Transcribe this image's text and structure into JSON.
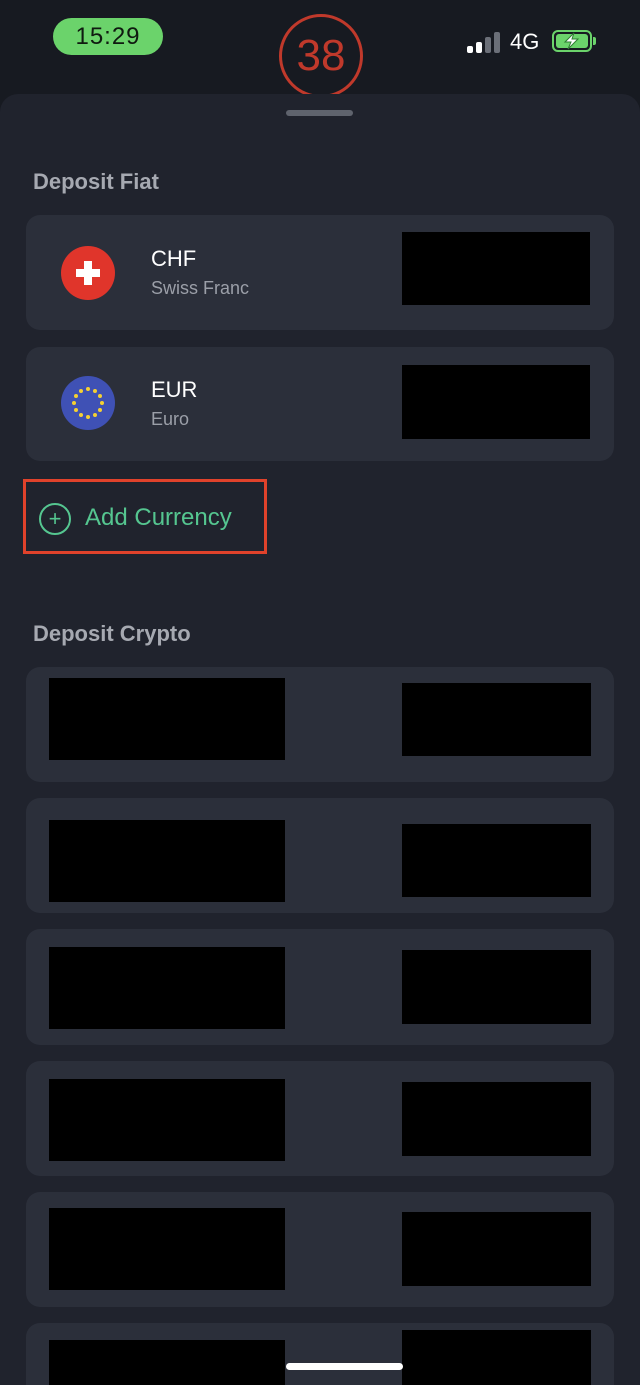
{
  "status_bar": {
    "time": "15:29",
    "counter": "38",
    "network": "4G"
  },
  "deposit_fiat": {
    "title": "Deposit Fiat",
    "items": [
      {
        "code": "CHF",
        "name": "Swiss Franc",
        "icon": "swiss-flag-icon"
      },
      {
        "code": "EUR",
        "name": "Euro",
        "icon": "eu-flag-icon"
      }
    ],
    "add_label": "Add Currency",
    "add_icon": "plus-circle-icon"
  },
  "deposit_crypto": {
    "title": "Deposit Crypto"
  },
  "colors": {
    "accent_green": "#55c690",
    "highlight_red": "#e0422b",
    "card_bg": "#2b2f3a",
    "sheet_bg": "#20232d"
  }
}
